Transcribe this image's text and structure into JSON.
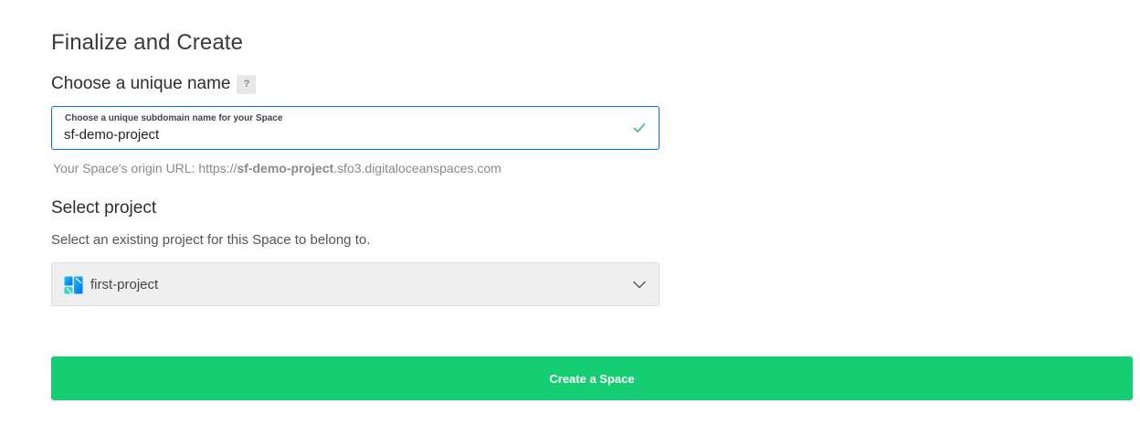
{
  "section": {
    "title": "Finalize and Create"
  },
  "name": {
    "heading": "Choose a unique name",
    "help_badge": "?",
    "field_label": "Choose a unique subdomain name for your Space",
    "value": "sf-demo-project",
    "valid_icon": "check-icon",
    "origin_prefix": "Your Space's origin URL: https://",
    "origin_name": "sf-demo-project",
    "origin_suffix": ".sfo3.digitaloceanspaces.com"
  },
  "project": {
    "heading": "Select project",
    "description": "Select an existing project for this Space to belong to.",
    "selected": "first-project",
    "icon": "project-icon",
    "dropdown_icon": "chevron-down-icon"
  },
  "actions": {
    "create_label": "Create a Space"
  },
  "colors": {
    "accent_blue": "#0069ff",
    "success_green": "#15cd72",
    "check_green": "#3fb57a"
  }
}
